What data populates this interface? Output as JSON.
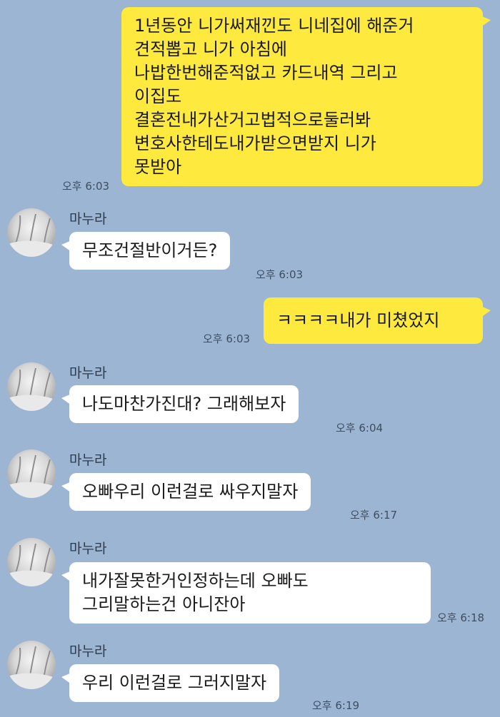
{
  "colors": {
    "background": "#9bb5d3",
    "my_bubble": "#fee93e",
    "their_bubble": "#ffffff"
  },
  "messages": [
    {
      "from": "me",
      "text": "1년동안 니가써재낀도 니네집에 해준거\n견적뽑고 니가 아침에\n나밥한번해준적없고 카드내역 그리고\n이집도\n결혼전내가산거고법적으로둘러봐\n변호사한테도내가받으면받지 니가\n못받아",
      "time": "오후 6:03"
    },
    {
      "from": "wife",
      "sender": "마누라",
      "avatar_icon": "profile-photo-snowy-trees",
      "text": "무조건절반이거든?",
      "time": "오후 6:03"
    },
    {
      "from": "me",
      "text": "ㅋㅋㅋㅋ내가 미쳤었지",
      "time": "오후 6:03"
    },
    {
      "from": "wife",
      "sender": "마누라",
      "avatar_icon": "profile-photo-snowy-trees",
      "text": "나도마찬가진대? 그래해보자",
      "time": "오후 6:04"
    },
    {
      "from": "wife",
      "sender": "마누라",
      "avatar_icon": "profile-photo-snowy-trees",
      "text": "오빠우리 이런걸로 싸우지말자",
      "time": "오후 6:17"
    },
    {
      "from": "wife",
      "sender": "마누라",
      "avatar_icon": "profile-photo-snowy-trees",
      "text": "내가잘못한거인정하는데 오빠도\n그리말하는건 아니잔아",
      "time": "오후 6:18"
    },
    {
      "from": "wife",
      "sender": "마누라",
      "avatar_icon": "profile-photo-snowy-trees",
      "text": "우리 이런걸로 그러지말자",
      "time": "오후 6:19"
    }
  ]
}
